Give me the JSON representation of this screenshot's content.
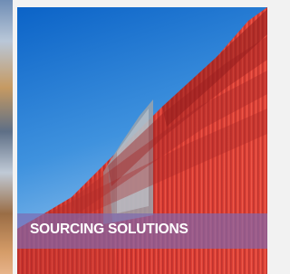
{
  "tile": {
    "banner_label": "SOURCING SOLUTIONS",
    "image_subject": "shipping-containers-photo",
    "banner_color": "#7e69b1",
    "container_color": "#d7372f",
    "sky_color": "#2a7fd0"
  }
}
